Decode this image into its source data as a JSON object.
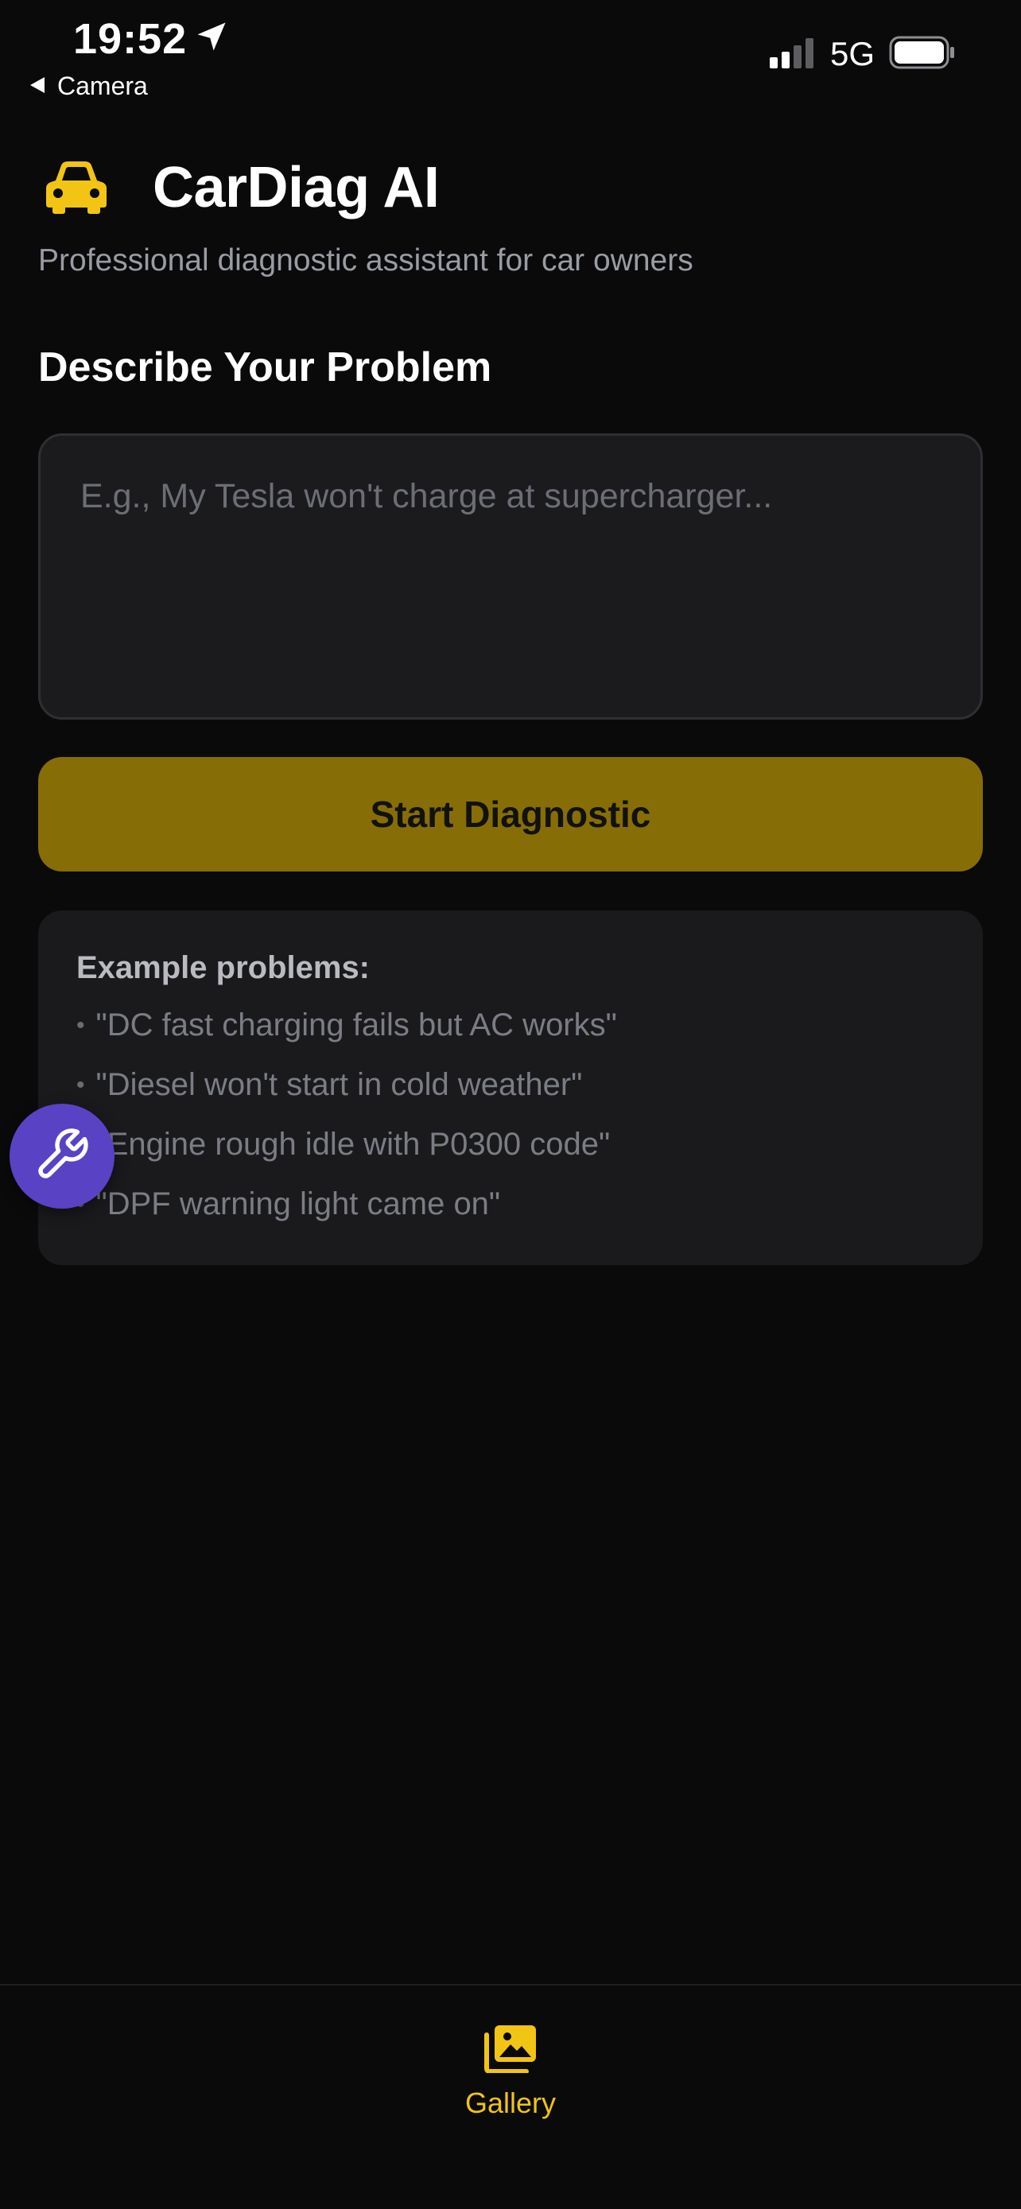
{
  "status_bar": {
    "time": "19:52",
    "back_app": "Camera",
    "network": "5G",
    "location-icon": "location-arrow-icon",
    "signal-icon": "signal-bars-icon",
    "battery-icon": "battery-icon"
  },
  "header": {
    "icon": "car-icon",
    "title": "CarDiag AI",
    "subtitle": "Professional diagnostic assistant for car owners"
  },
  "form": {
    "section_title": "Describe Your Problem",
    "input_placeholder": "E.g., My Tesla won't charge at supercharger...",
    "input_value": "",
    "submit_label": "Start Diagnostic"
  },
  "examples": {
    "heading": "Example problems:",
    "items": [
      "\"DC fast charging fails but AC works\"",
      "\"Diesel won't start in cold weather\"",
      "\"Engine rough idle with P0300 code\"",
      "\"DPF warning light came on\""
    ]
  },
  "fab": {
    "icon": "wrench-icon"
  },
  "tab_bar": {
    "items": [
      {
        "label": "Gallery",
        "icon": "gallery-icon"
      }
    ]
  },
  "colors": {
    "background": "#0a0a0b",
    "accent": "#f2c414",
    "button": "#866d06",
    "fab": "#5a42c4"
  }
}
